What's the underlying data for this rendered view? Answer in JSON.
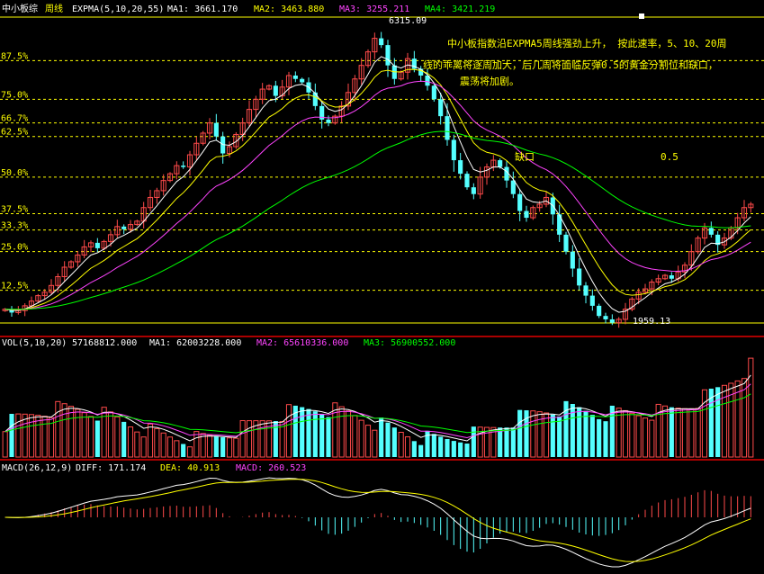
{
  "chart_data": {
    "type": "candlestick",
    "price_panel": {
      "header": {
        "title": "中小板综",
        "period": "周线",
        "indicator": "EXPMA(5,10,20,55)",
        "ma1": "MA1: 3661.170",
        "ma2": "MA2: 3463.880",
        "ma3": "MA3: 3255.211",
        "ma4": "MA4: 3421.219"
      },
      "ylim": [
        1850,
        6500
      ],
      "high_label": "6315.09",
      "low_label": "1959.13",
      "fib_levels": [
        {
          "label": "87.5%",
          "value": 5870
        },
        {
          "label": "75.0%",
          "value": 5300
        },
        {
          "label": "66.7%",
          "value": 4950
        },
        {
          "label": "62.5%",
          "value": 4750
        },
        {
          "label": "50.0%",
          "value": 4150
        },
        {
          "label": "37.5%",
          "value": 3610
        },
        {
          "label": "33.3%",
          "value": 3370
        },
        {
          "label": "25.0%",
          "value": 3050
        },
        {
          "label": "12.5%",
          "value": 2480
        }
      ],
      "annotation_lines": [
        "中小板指数沿EXPMA5周线强劲上升， 按此速率，5、10、20周",
        "线的乖离将逐周加大，后几周将面临反弹0.5的黄金分割位和缺口，",
        "震荡将加剧。"
      ],
      "gap_label": "缺口",
      "half_label": "0.5",
      "closes": [
        2200,
        2150,
        2180,
        2250,
        2320,
        2400,
        2450,
        2550,
        2680,
        2820,
        2900,
        3000,
        3120,
        3180,
        3100,
        3200,
        3300,
        3420,
        3380,
        3450,
        3500,
        3700,
        3850,
        3950,
        4100,
        4200,
        4320,
        4300,
        4480,
        4650,
        4800,
        4950,
        4750,
        4500,
        4600,
        4780,
        4950,
        5150,
        5300,
        5450,
        5500,
        5350,
        5480,
        5650,
        5600,
        5550,
        5400,
        5200,
        5000,
        4950,
        5050,
        5200,
        5400,
        5600,
        5800,
        6000,
        6200,
        6100,
        5800,
        5600,
        5700,
        5900,
        5750,
        5650,
        5500,
        5300,
        5050,
        4700,
        4400,
        4200,
        4000,
        3900,
        4150,
        4300,
        4400,
        4300,
        4100,
        3900,
        3650,
        3550,
        3700,
        3750,
        3850,
        3600,
        3300,
        3050,
        2800,
        2550,
        2400,
        2250,
        2100,
        2050,
        2000,
        2050,
        2200,
        2350,
        2450,
        2500,
        2600,
        2650,
        2700,
        2650,
        2750,
        2850,
        3050,
        3250,
        3400,
        3300,
        3150,
        3250,
        3400,
        3550,
        3700,
        3750
      ]
    },
    "volume_panel": {
      "label": "VOL(5,10,20)",
      "vol": "57168812.000",
      "ma1": "MA1: 62003228.000",
      "ma2": "MA2: 65610336.000",
      "ma3": "MA3: 56900552.000"
    },
    "macd_panel": {
      "label": "MACD(26,12,9)",
      "diff": "DIFF: 171.174",
      "dea": "DEA: 40.913",
      "macd": "MACD: 260.523"
    },
    "colors": {
      "up": "#ff4a4a",
      "down": "#54ffff",
      "ma1": "#ffffff",
      "ma2": "#ffff00",
      "ma3": "#ff44ff",
      "ma4": "#00ff00",
      "fib": "#ffff00",
      "annotation": "#ffff00",
      "divider": "#aa0000"
    }
  }
}
